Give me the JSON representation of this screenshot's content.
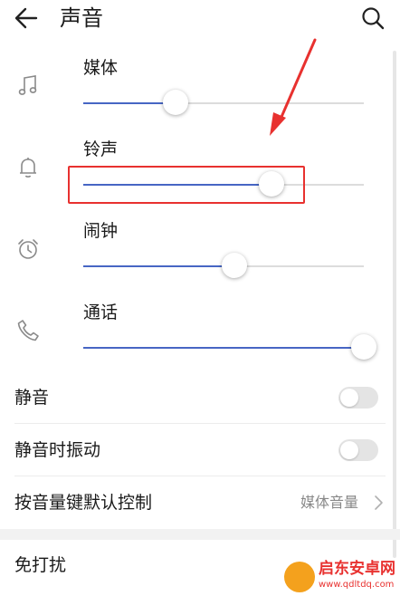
{
  "header": {
    "title": "声音",
    "back_icon": "arrow-left-icon",
    "search_icon": "search-icon"
  },
  "volume": [
    {
      "key": "media",
      "label": "媒体",
      "icon": "music-note-icon",
      "level": 0.33
    },
    {
      "key": "ringtone",
      "label": "铃声",
      "icon": "bell-icon",
      "level": 0.67
    },
    {
      "key": "alarm",
      "label": "闹钟",
      "icon": "alarm-clock-icon",
      "level": 0.54
    },
    {
      "key": "call",
      "label": "通话",
      "icon": "phone-icon",
      "level": 1.0
    }
  ],
  "settings": [
    {
      "key": "mute",
      "label": "静音",
      "toggle": false
    },
    {
      "key": "vibrate_on_mute",
      "label": "静音时振动",
      "toggle": false
    },
    {
      "key": "volume_key_default",
      "label": "按音量键默认控制",
      "value": "媒体音量"
    },
    {
      "key": "dnd",
      "label": "免打扰"
    }
  ],
  "watermark": {
    "title": "启东安卓网",
    "url": "www.qdltdq.com"
  },
  "colors": {
    "slider_fill": "#4766c4",
    "slider_track": "#dcdcdc",
    "annotation": "#e8312f",
    "toggle_off": "#e4e4e4"
  }
}
